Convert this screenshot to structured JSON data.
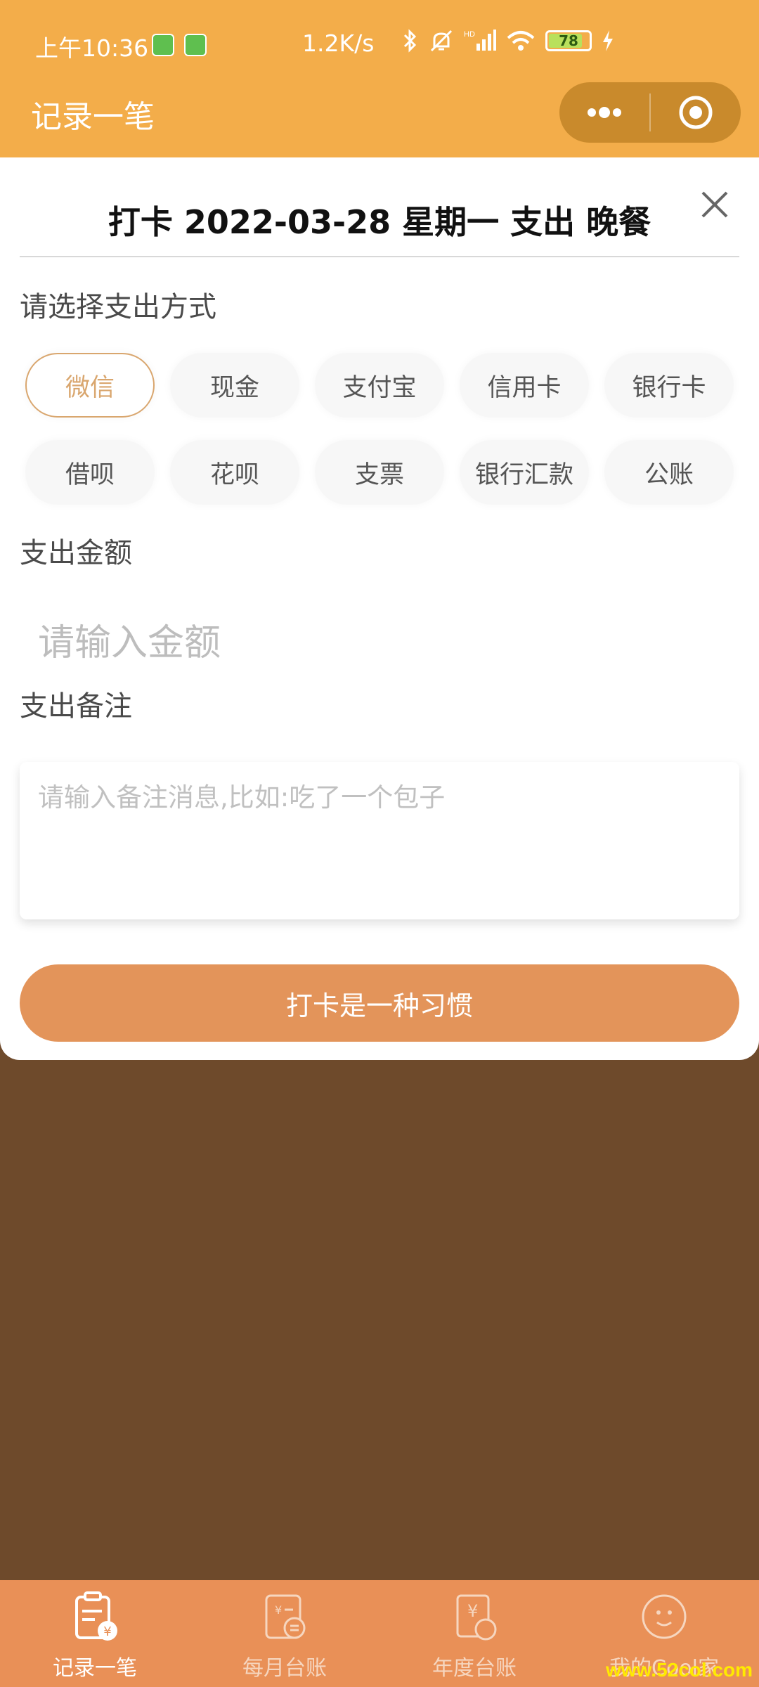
{
  "status_bar": {
    "time": "上午10:36",
    "speed": "1.2K/s",
    "battery_level": "78",
    "icons": [
      "bluetooth-icon",
      "mute-icon",
      "signal-icon",
      "wifi-icon",
      "battery-icon",
      "charging-icon"
    ]
  },
  "nav": {
    "title": "记录一笔",
    "menu_icon": "more-icon",
    "close_icon": "target-icon"
  },
  "card": {
    "title": "打卡 2022-03-28 星期一 支出 晚餐",
    "method_label": "请选择支出方式",
    "methods_row1": [
      "微信",
      "现金",
      "支付宝",
      "信用卡",
      "银行卡"
    ],
    "methods_row2": [
      "借呗",
      "花呗",
      "支票",
      "银行汇款",
      "公账"
    ],
    "selected_method": "微信",
    "amount_label": "支出金额",
    "amount_placeholder": "请输入金额",
    "remark_label": "支出备注",
    "remark_placeholder": "请输入备注消息,比如:吃了一个包子",
    "submit_label": "打卡是一种习惯"
  },
  "tabbar": {
    "tabs": [
      {
        "label": "记录一笔",
        "icon": "record-icon",
        "active": true
      },
      {
        "label": "每月台账",
        "icon": "calculator-icon",
        "active": false
      },
      {
        "label": "年度台账",
        "icon": "yearly-ledger-icon",
        "active": false
      },
      {
        "label": "我的Cool家",
        "icon": "smile-face-icon",
        "active": false
      }
    ]
  },
  "watermark": "www.52col.com",
  "colors": {
    "header": "#f3ad4a",
    "background": "#6e4a2b",
    "accent": "#e3945a",
    "selected_chip": "#d9a66e",
    "tabbar": "#e99057"
  }
}
